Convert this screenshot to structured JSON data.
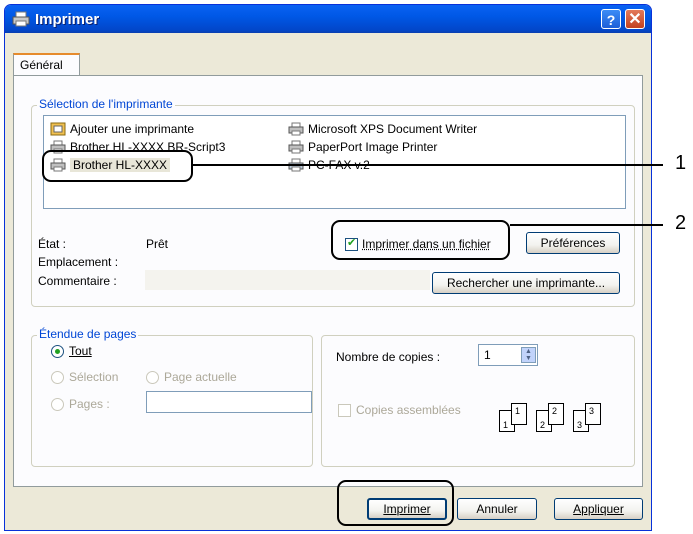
{
  "window": {
    "title": "Imprimer",
    "help_label": "?",
    "close_label": "✕"
  },
  "tabs": [
    {
      "label": "Général"
    }
  ],
  "printer_group": {
    "legend": "Sélection de l'imprimante",
    "printers": [
      {
        "name": "Ajouter une imprimante",
        "icon": "add-printer-icon"
      },
      {
        "name": "Brother HL-XXXX BR-Script3",
        "icon": "printer-icon"
      },
      {
        "name": "Brother HL-XXXX",
        "icon": "printer-icon",
        "selected": true
      },
      {
        "name": "Microsoft XPS Document Writer",
        "icon": "printer-icon"
      },
      {
        "name": "PaperPort Image Printer",
        "icon": "printer-icon"
      },
      {
        "name": "PC-FAX v.2",
        "icon": "fax-printer-icon"
      }
    ],
    "status_label": "État :",
    "status_value": "Prêt",
    "location_label": "Emplacement :",
    "comment_label": "Commentaire :",
    "print_to_file_label": "Imprimer dans un fichier",
    "print_to_file_checked": true,
    "preferences_label": "Préférences",
    "find_printer_label": "Rechercher une imprimante..."
  },
  "range_group": {
    "legend": "Étendue de pages",
    "all_label": "Tout",
    "selection_label": "Sélection",
    "current_page_label": "Page actuelle",
    "pages_label": "Pages :"
  },
  "copies_group": {
    "copies_label": "Nombre de copies :",
    "copies_value": "1",
    "collate_label": "Copies assemblées",
    "page_digits": [
      "1",
      "1",
      "2",
      "2",
      "3",
      "3"
    ]
  },
  "buttons": {
    "print": "Imprimer",
    "cancel": "Annuler",
    "apply": "Appliquer"
  },
  "callouts": {
    "one": "1",
    "two": "2"
  }
}
